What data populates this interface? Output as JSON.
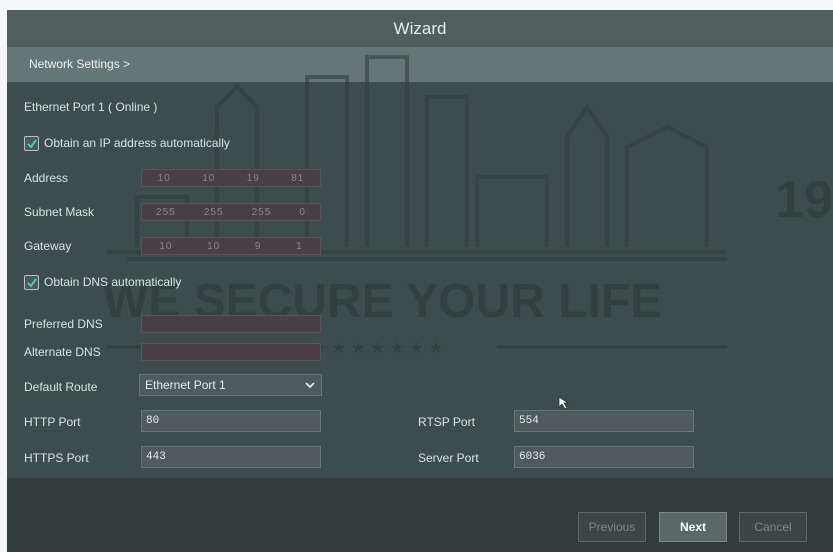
{
  "window": {
    "title": "Wizard"
  },
  "breadcrumb": "Network Settings >",
  "ethernet": {
    "title": "Ethernet Port 1 ( Online )"
  },
  "ip_auto": {
    "label": "Obtain an IP address automatically",
    "checked": true
  },
  "address": {
    "label": "Address",
    "octets": [
      "10",
      "10",
      "19",
      "81"
    ]
  },
  "subnet": {
    "label": "Subnet Mask",
    "octets": [
      "255",
      "255",
      "255",
      "0"
    ]
  },
  "gateway": {
    "label": "Gateway",
    "octets": [
      "10",
      "10",
      "9",
      "1"
    ]
  },
  "dns_auto": {
    "label": "Obtain DNS automatically",
    "checked": true
  },
  "preferred_dns": {
    "label": "Preferred DNS"
  },
  "alternate_dns": {
    "label": "Alternate DNS"
  },
  "default_route": {
    "label": "Default Route",
    "value": "Ethernet Port 1"
  },
  "http_port": {
    "label": "HTTP Port",
    "value": "80"
  },
  "https_port": {
    "label": "HTTPS Port",
    "value": "443"
  },
  "rtsp_port": {
    "label": "RTSP Port",
    "value": "554"
  },
  "server_port": {
    "label": "Server Port",
    "value": "6036"
  },
  "buttons": {
    "previous": "Previous",
    "next": "Next",
    "cancel": "Cancel"
  },
  "watermark": {
    "slogan": "WE SECURE YOUR LIFE",
    "stars": "★ ★ ★ ★ ★ ★ ★",
    "side_number": "19"
  },
  "icons": {
    "checkbox": "checkmark-icon",
    "dropdown": "chevron-down-icon",
    "pointer": "mouse-cursor-icon"
  },
  "colors": {
    "accent_check": "#58c7b0",
    "window_bg": "#3d4d4d",
    "title_bg": "#505e5e"
  }
}
